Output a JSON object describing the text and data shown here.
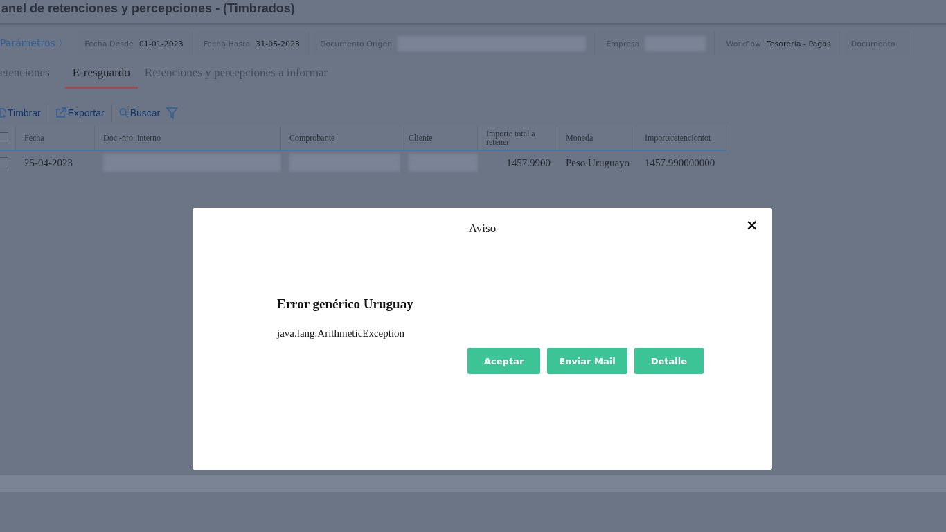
{
  "page_title": "anel de retenciones y percepciones - (Timbrados)",
  "params": {
    "link": "Parámetros 〉",
    "fields": [
      {
        "label": "Fecha Desde",
        "value": "01-01-2023",
        "kind": "text"
      },
      {
        "label": "Fecha Hasta",
        "value": "31-05-2023",
        "kind": "text"
      },
      {
        "label": "Documento Origen",
        "kind": "redacted"
      },
      {
        "label": "Empresa",
        "kind": "redacted"
      },
      {
        "label": "Workflow",
        "value": "Tesorería - Pagos",
        "kind": "text"
      },
      {
        "label": "Documento",
        "kind": "label"
      }
    ]
  },
  "tabs": [
    {
      "label": "etenciones",
      "selected": false
    },
    {
      "label": "E-resguardo",
      "selected": true
    },
    {
      "label": "Retenciones y percepciones a informar",
      "selected": false
    }
  ],
  "toolbar": [
    {
      "label": "Timbrar",
      "kind": "stamp"
    },
    {
      "label": "Exportar",
      "kind": "export"
    },
    {
      "label": "Buscar",
      "kind": "search"
    },
    {
      "kind": "filter"
    }
  ],
  "table": {
    "header_checked": false,
    "columns": [
      "Fecha",
      "Doc.-nro. interno",
      "Comprobante",
      "Cliente",
      "Importe total a retener",
      "Moneda",
      "Importeretenciontot"
    ],
    "rows": [
      {
        "checked": false,
        "cells": [
          {
            "kind": "text",
            "text": "25-04-2023"
          },
          {
            "kind": "redacted"
          },
          {
            "kind": "redacted"
          },
          {
            "kind": "redacted"
          },
          {
            "kind": "amount",
            "text": "1457.9900"
          },
          {
            "kind": "text",
            "text": "Peso Uruguayo"
          },
          {
            "kind": "text",
            "text": "1457.990000000"
          }
        ]
      }
    ]
  },
  "dialog": {
    "title": "Aviso",
    "close": "×",
    "heading": "Error genérico Uruguay",
    "message": "java.lang.ArithmeticException",
    "buttons": [
      "Aceptar",
      "Enviar Mail",
      "Detalle"
    ]
  }
}
